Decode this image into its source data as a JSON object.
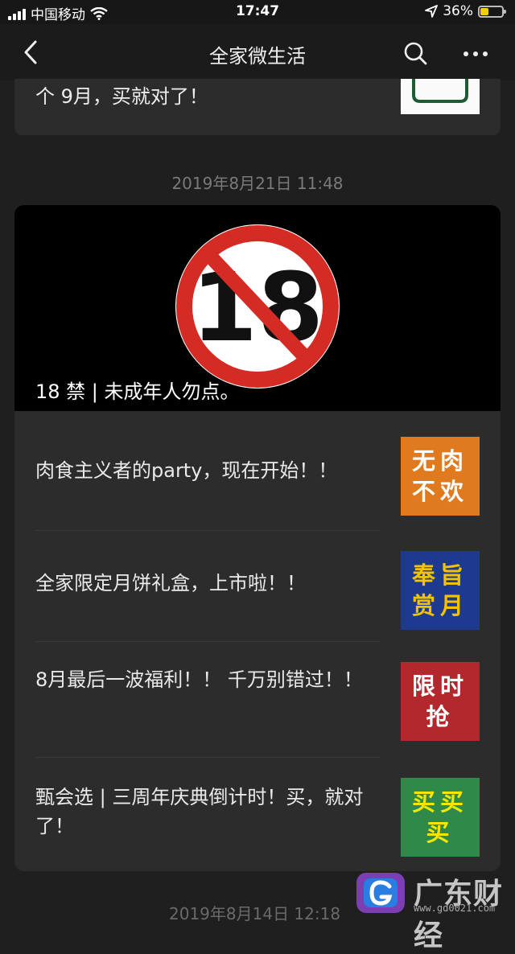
{
  "status_bar": {
    "carrier": "中国移动",
    "time": "17:47",
    "battery_percent": "36%",
    "battery_level": 0.36,
    "icons": [
      "signal-icon",
      "wifi-icon",
      "location-arrow-icon",
      "battery-icon"
    ]
  },
  "nav": {
    "title": "全家微生活",
    "icons": [
      "back-icon",
      "search-icon",
      "more-icon"
    ]
  },
  "prev_card": {
    "title_tail": "个 9月，买就对了！"
  },
  "message_time": "2019年8月21日 11:48",
  "cover": {
    "badge_text": "18",
    "title": "18 禁 | 未成年人勿点。"
  },
  "articles": [
    {
      "title": "肉食主义者的party，现在开始！！",
      "thumb_text": "无肉\n不欢",
      "thumb_bg": "#e07a1f",
      "thumb_fg": "#ffffff"
    },
    {
      "title": "全家限定月饼礼盒，上市啦！！",
      "thumb_text": "奉旨\n赏月",
      "thumb_bg": "#1d3a8f",
      "thumb_fg": "#f5c200"
    },
    {
      "title": "8月最后一波福利！！ 千万别错过！！",
      "thumb_text": "限时\n抢",
      "thumb_bg": "#b3282d",
      "thumb_fg": "#ffffff"
    },
    {
      "title": "甄会选 | 三周年庆典倒计时！买，就对了！",
      "thumb_text": "买买\n买",
      "thumb_bg": "#2f8a4a",
      "thumb_fg": "#f5e700"
    }
  ],
  "next_time_partial": "2019年8月14日 12:18",
  "watermark": {
    "name": "广东财经",
    "url": "www.gd0021.com"
  },
  "colors": {
    "background": "#1f1f1f",
    "card": "#2c2c2c",
    "no_sign_red": "#d42b24"
  }
}
